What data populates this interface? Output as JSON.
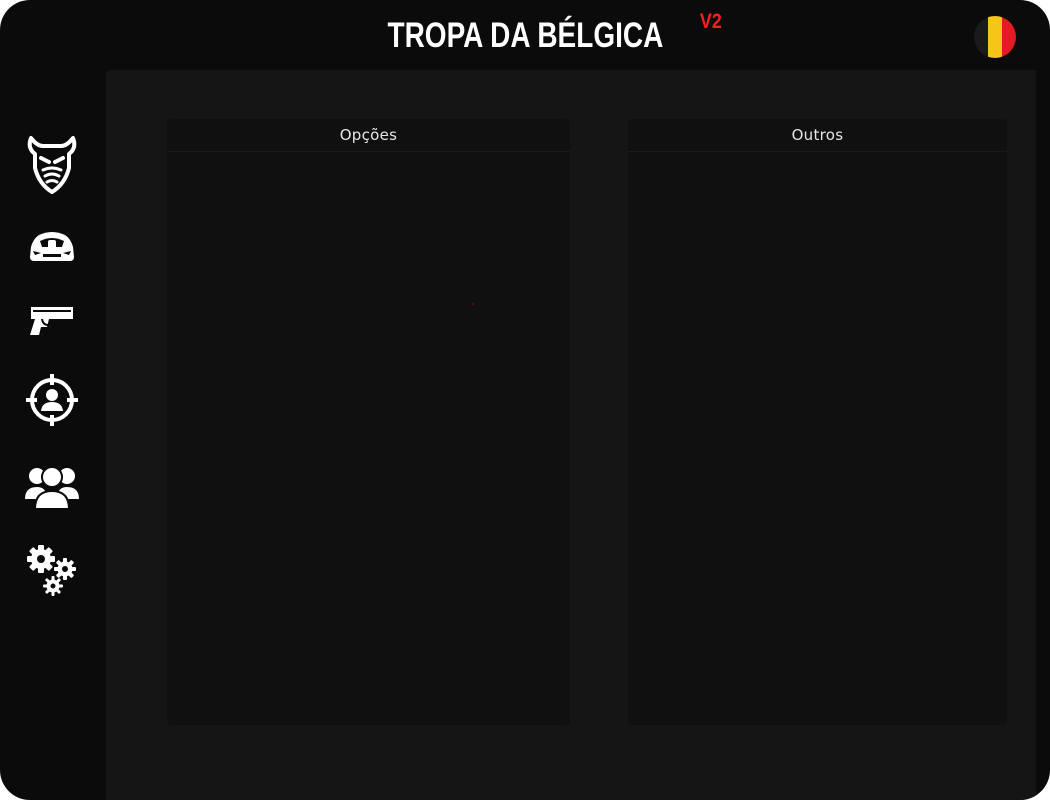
{
  "app": {
    "title": "TROPA DA BÉLGICA",
    "version": "V2"
  },
  "colors": {
    "background": "#0b0b0b",
    "content_bg": "#151515",
    "panel_bg": "#101010",
    "accent": "#ff1e1e",
    "text": "#ffffff"
  },
  "flag": {
    "name": "belgium-flag-icon",
    "colors": [
      "#1a1a1a",
      "#f5c518",
      "#e31b23"
    ]
  },
  "sidebar": {
    "items": [
      {
        "icon": "cow-skull-icon"
      },
      {
        "icon": "car-icon"
      },
      {
        "icon": "pistol-icon"
      },
      {
        "icon": "target-player-icon"
      },
      {
        "icon": "users-group-icon"
      },
      {
        "icon": "gears-icon"
      }
    ]
  },
  "panels": {
    "options": {
      "title": "Opções"
    },
    "others": {
      "title": "Outros"
    }
  }
}
